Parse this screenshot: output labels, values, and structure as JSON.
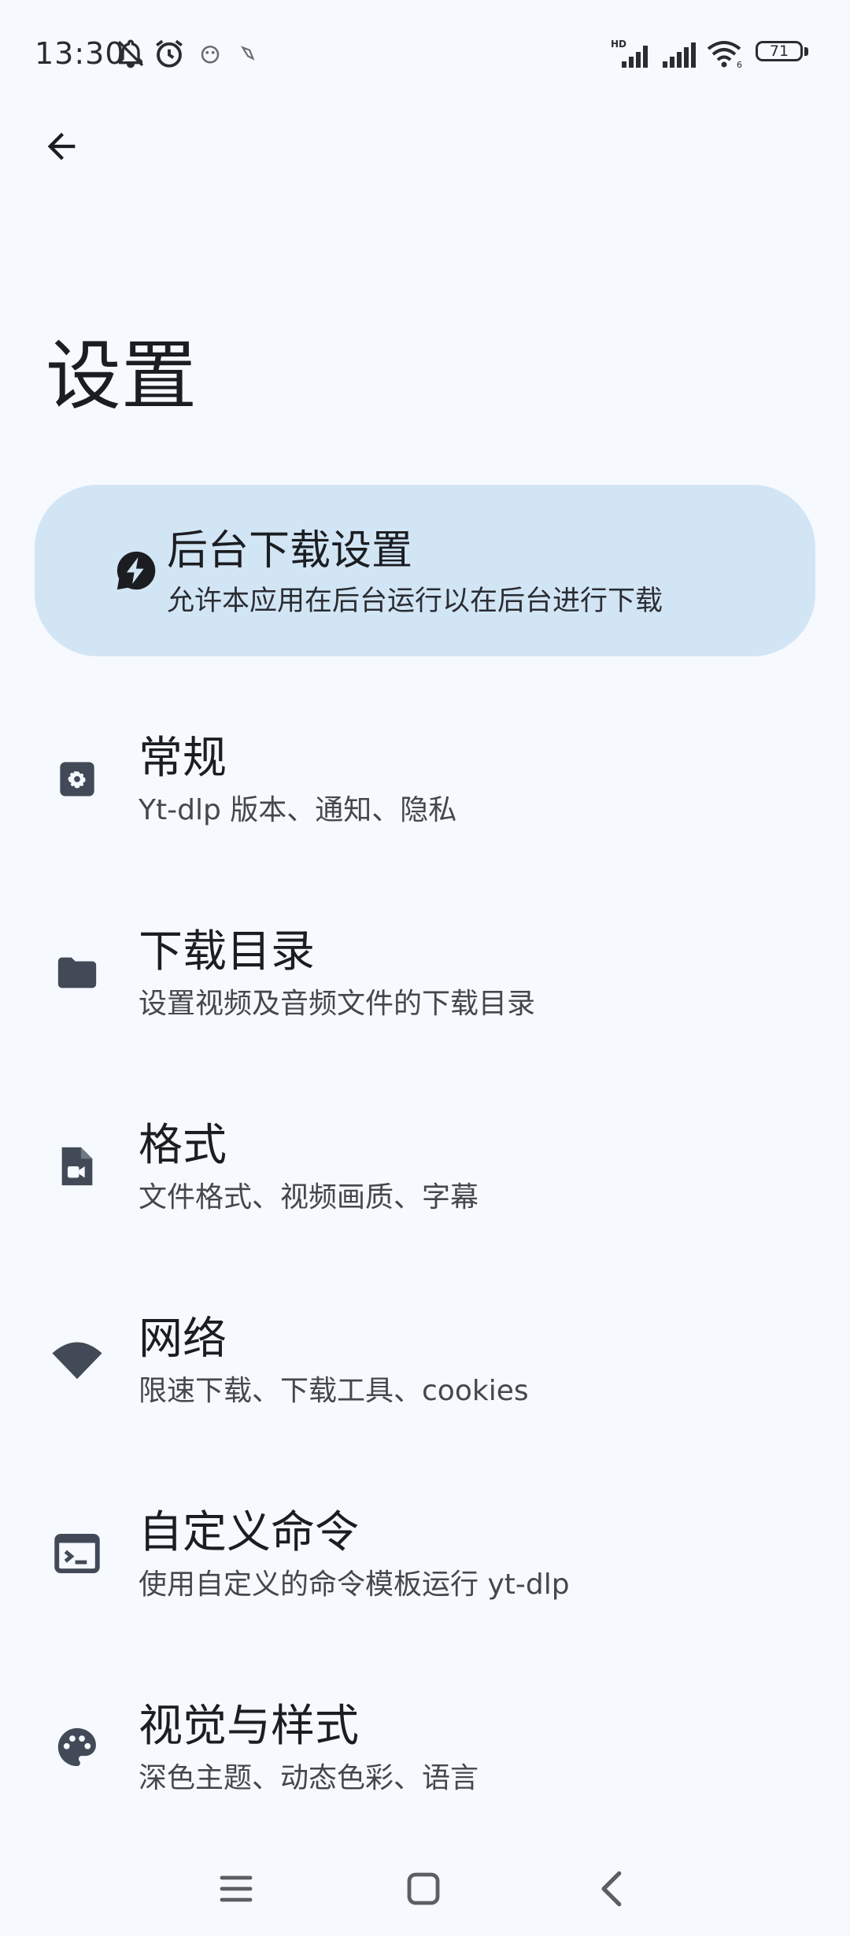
{
  "status_bar": {
    "time": "13:30",
    "battery": "71",
    "network_label": "HD",
    "icons": [
      "bell-off-icon",
      "alarm-icon",
      "app-notification-icon",
      "app-notification-icon-2",
      "signal-hd-icon",
      "signal-icon",
      "wifi-icon",
      "battery-icon"
    ]
  },
  "header": {
    "title": "设置"
  },
  "background_download": {
    "title": "后台下载设置",
    "description": "允许本应用在后台运行以在后台进行下载"
  },
  "settings": [
    {
      "title": "常规",
      "description": "Yt-dlp 版本、通知、隐私",
      "icon": "settings-gear-icon"
    },
    {
      "title": "下载目录",
      "description": "设置视频及音频文件的下载目录",
      "icon": "folder-icon"
    },
    {
      "title": "格式",
      "description": "文件格式、视频画质、字幕",
      "icon": "video-file-icon"
    },
    {
      "title": "网络",
      "description": "限速下载、下载工具、cookies",
      "icon": "wifi-icon"
    },
    {
      "title": "自定义命令",
      "description": "使用自定义的命令模板运行 yt-dlp",
      "icon": "terminal-icon"
    },
    {
      "title": "视觉与样式",
      "description": "深色主题、动态色彩、语言",
      "icon": "palette-icon"
    }
  ],
  "colors": {
    "background": "#f6f9fe",
    "card": "#d2e5f5",
    "icon": "#414a56",
    "text_primary": "#1b1d21",
    "text_secondary": "#44474c"
  }
}
